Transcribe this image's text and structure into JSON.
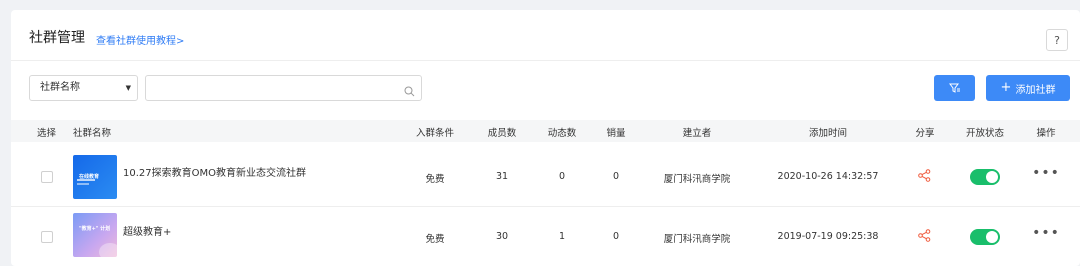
{
  "header": {
    "title": "社群管理",
    "tutorial_link": "查看社群使用教程>",
    "help_label": "?"
  },
  "filter": {
    "select_value": "社群名称",
    "search_placeholder": "",
    "add_button_label": "添加社群"
  },
  "table": {
    "columns": [
      "选择",
      "社群名称",
      "入群条件",
      "成员数",
      "动态数",
      "销量",
      "建立者",
      "添加时间",
      "分享",
      "开放状态",
      "操作"
    ],
    "rows": [
      {
        "name": "10.27探索教育OMO教育新业态交流社群",
        "condition": "免费",
        "members": "31",
        "posts": "0",
        "sales": "0",
        "creator": "厦门科汛商学院",
        "added_time": "2020-10-26 14:32:57",
        "thumb_text": "在线教育",
        "open": true
      },
      {
        "name": "超级教育+",
        "condition": "免费",
        "members": "30",
        "posts": "1",
        "sales": "0",
        "creator": "厦门科汛商学院",
        "added_time": "2019-07-19 09:25:38",
        "thumb_text": "\"教育+\" 计划",
        "open": true
      }
    ]
  },
  "colors": {
    "primary": "#3d8af7",
    "link": "#2f7cf5",
    "toggle_on": "#19be6b",
    "share_icon": "#f05a3c"
  }
}
